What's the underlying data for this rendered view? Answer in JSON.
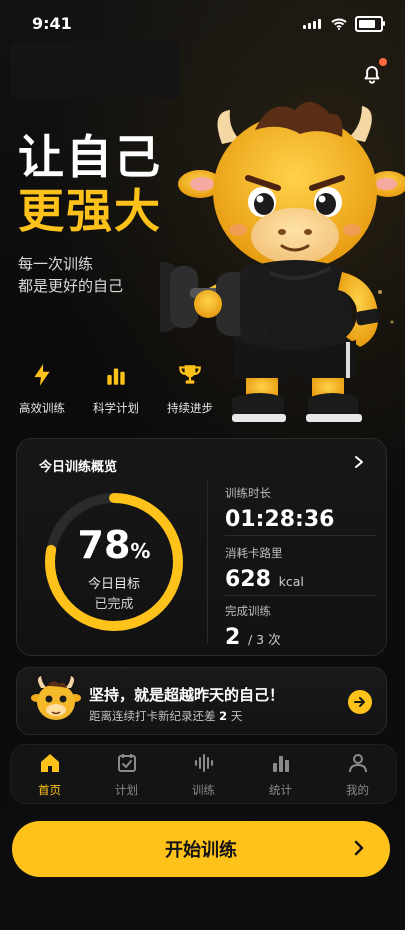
{
  "status": {
    "time": "9:41"
  },
  "hero": {
    "title_line1": "让自己",
    "title_line2": "更强大",
    "subtitle_line1": "每一次训练",
    "subtitle_line2": "都是更好的自己"
  },
  "features": [
    {
      "label": "高效训练",
      "icon": "lightning-icon"
    },
    {
      "label": "科学计划",
      "icon": "bar-chart-icon"
    },
    {
      "label": "持续进步",
      "icon": "trophy-icon"
    }
  ],
  "overview": {
    "title": "今日训练概览",
    "progress_percent": 78,
    "percent_text": "78",
    "percent_sign": "%",
    "ring_label1": "今日目标",
    "ring_label2": "已完成",
    "duration_label": "训练时长",
    "duration_value": "01:28:36",
    "calories_label": "消耗卡路里",
    "calories_value": "628",
    "calories_unit": "kcal",
    "completed_label": "完成训练",
    "completed_value": "2",
    "completed_total": "/ 3 次"
  },
  "banner": {
    "title": "坚持，就是超越昨天的自己！",
    "subtitle_prefix": "距离连续打卡新纪录还差",
    "subtitle_days": "2",
    "subtitle_suffix": "天"
  },
  "nav": [
    {
      "label": "首页",
      "icon": "home-icon",
      "active": true
    },
    {
      "label": "计划",
      "icon": "calendar-check-icon",
      "active": false
    },
    {
      "label": "训练",
      "icon": "waveform-icon",
      "active": false
    },
    {
      "label": "统计",
      "icon": "stats-icon",
      "active": false
    },
    {
      "label": "我的",
      "icon": "user-icon",
      "active": false
    }
  ],
  "cta": {
    "label": "开始训练"
  },
  "colors": {
    "accent": "#ffc21a",
    "background": "#0b0b0c",
    "card": "#151515",
    "notification": "#ff6a3d"
  }
}
